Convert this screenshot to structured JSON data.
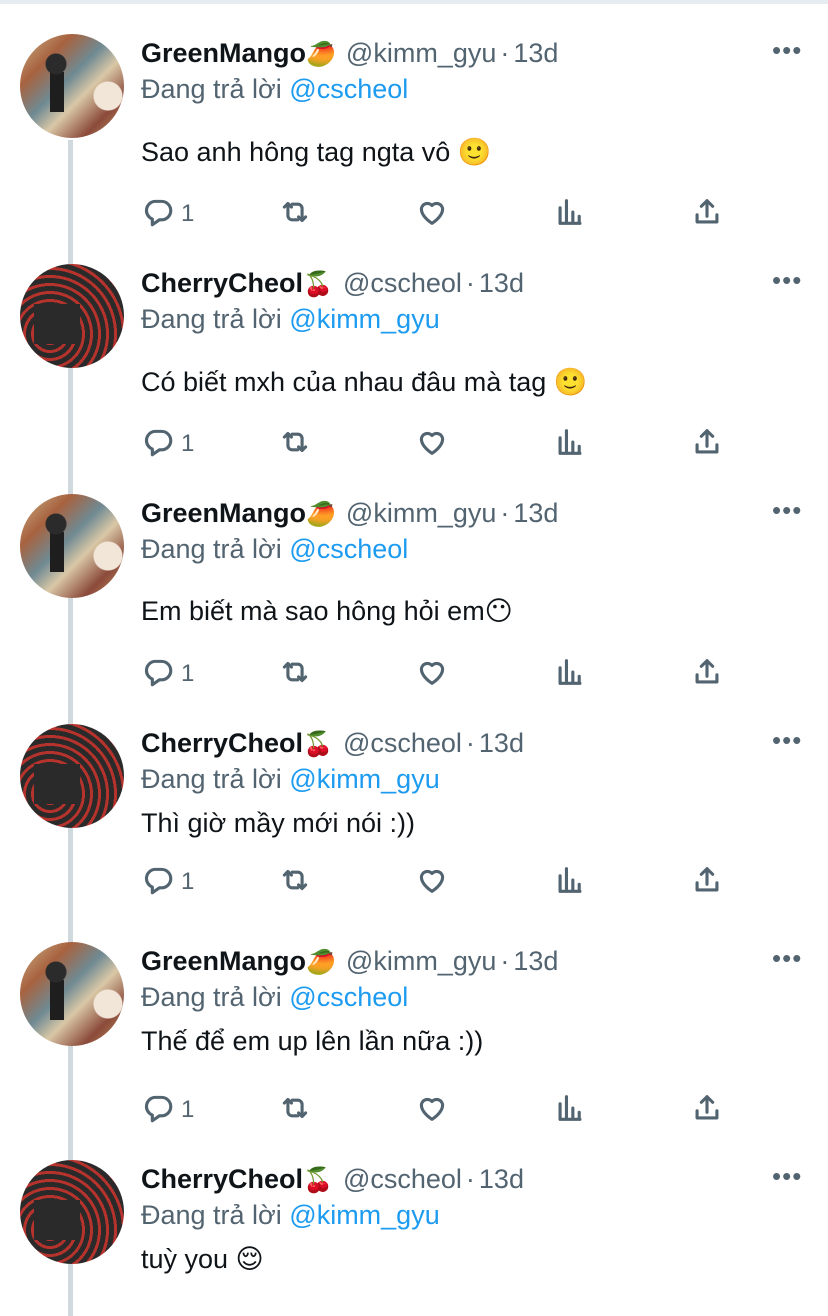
{
  "replying_label": "Đang trả lời",
  "tweets": [
    {
      "name": "GreenMango",
      "badge": "🥭",
      "handle": "@kimm_gyu",
      "dot": "·",
      "time": "13d",
      "reply_to": "@cscheol",
      "text": "Sao anh hông tag ngta vô 🙂",
      "reply_count": "1",
      "avatar": "mango"
    },
    {
      "name": "CherryCheol",
      "badge": "🍒",
      "handle": "@cscheol",
      "dot": "·",
      "time": "13d",
      "reply_to": "@kimm_gyu",
      "text": "Có biết mxh của nhau đâu mà tag 🙂",
      "reply_count": "1",
      "avatar": "cherry"
    },
    {
      "name": "GreenMango",
      "badge": "🥭",
      "handle": "@kimm_gyu",
      "dot": "·",
      "time": "13d",
      "reply_to": "@cscheol",
      "text": "Em biết mà sao hông hỏi em😶",
      "reply_count": "1",
      "avatar": "mango"
    },
    {
      "name": "CherryCheol",
      "badge": "🍒",
      "handle": "@cscheol",
      "dot": "·",
      "time": "13d",
      "reply_to": "@kimm_gyu",
      "text": "Thì giờ mầy mới nói :))",
      "reply_count": "1",
      "avatar": "cherry"
    },
    {
      "name": "GreenMango",
      "badge": "🥭",
      "handle": "@kimm_gyu",
      "dot": "·",
      "time": "13d",
      "reply_to": "@cscheol",
      "text": "Thế để em up lên lần nữa :))",
      "reply_count": "1",
      "avatar": "mango"
    },
    {
      "name": "CherryCheol",
      "badge": "🍒",
      "handle": "@cscheol",
      "dot": "·",
      "time": "13d",
      "reply_to": "@kimm_gyu",
      "text": "tuỳ you 😌",
      "reply_count": "",
      "avatar": "cherry"
    }
  ],
  "icons": {
    "reply": "reply-icon",
    "retweet": "retweet-icon",
    "like": "heart-icon",
    "stats": "stats-icon",
    "share": "share-icon",
    "more": "more-icon"
  }
}
